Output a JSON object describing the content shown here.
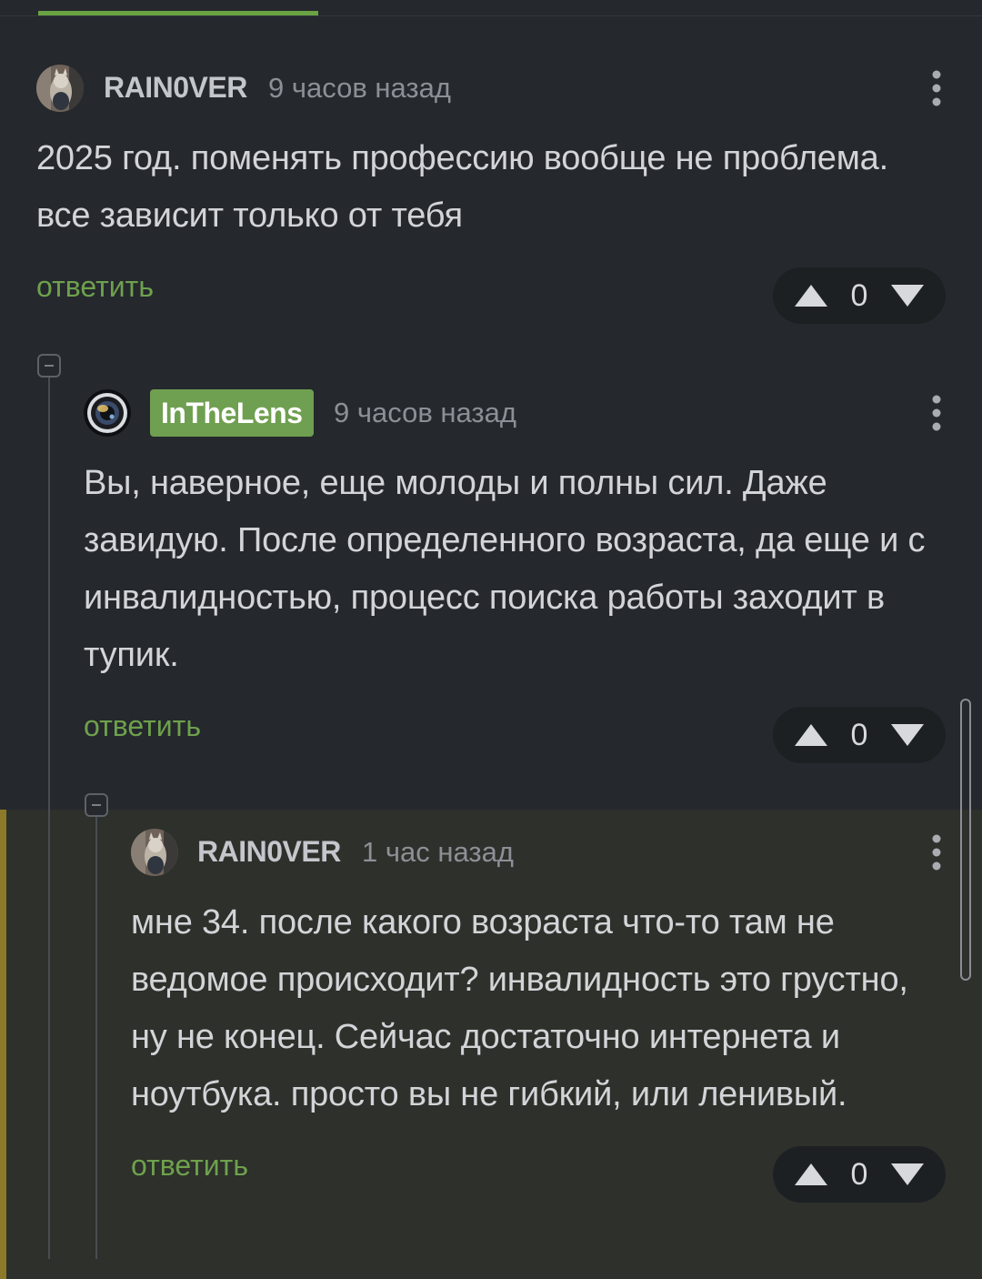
{
  "comments": [
    {
      "author": "RAIN0VER",
      "time": "9 часов назад",
      "text": "2025 год. поменять профессию вообще не проблема. все зависит только от тебя",
      "reply_label": "ответить",
      "rating": "0",
      "avatar_icon": "cat-avatar-icon"
    },
    {
      "author": "InTheLens",
      "time": "9 часов назад",
      "text": "Вы, наверное, еще молоды и полны сил. Даже завидую. После определенного возраста, да еще и с инвалидностью, процесс поиска работы заходит в тупик.",
      "reply_label": "ответить",
      "rating": "0",
      "avatar_icon": "lens-avatar-icon",
      "badge_color": "#6f9f50"
    },
    {
      "author": "RAIN0VER",
      "time": "1 час назад",
      "text": "мне 34. после какого возраста что-то там не ведомое происходит? инвалидность это грустно, ну не конец. Сейчас достаточно интернета и ноутбука. просто вы не гибкий, или ленивый.",
      "reply_label": "ответить",
      "rating": "0",
      "avatar_icon": "cat-avatar-icon",
      "highlight_color": "#8c7a2a"
    }
  ],
  "colors": {
    "accent_green": "#6aa344",
    "background": "#25282d",
    "highlight_background": "#2d302b"
  }
}
